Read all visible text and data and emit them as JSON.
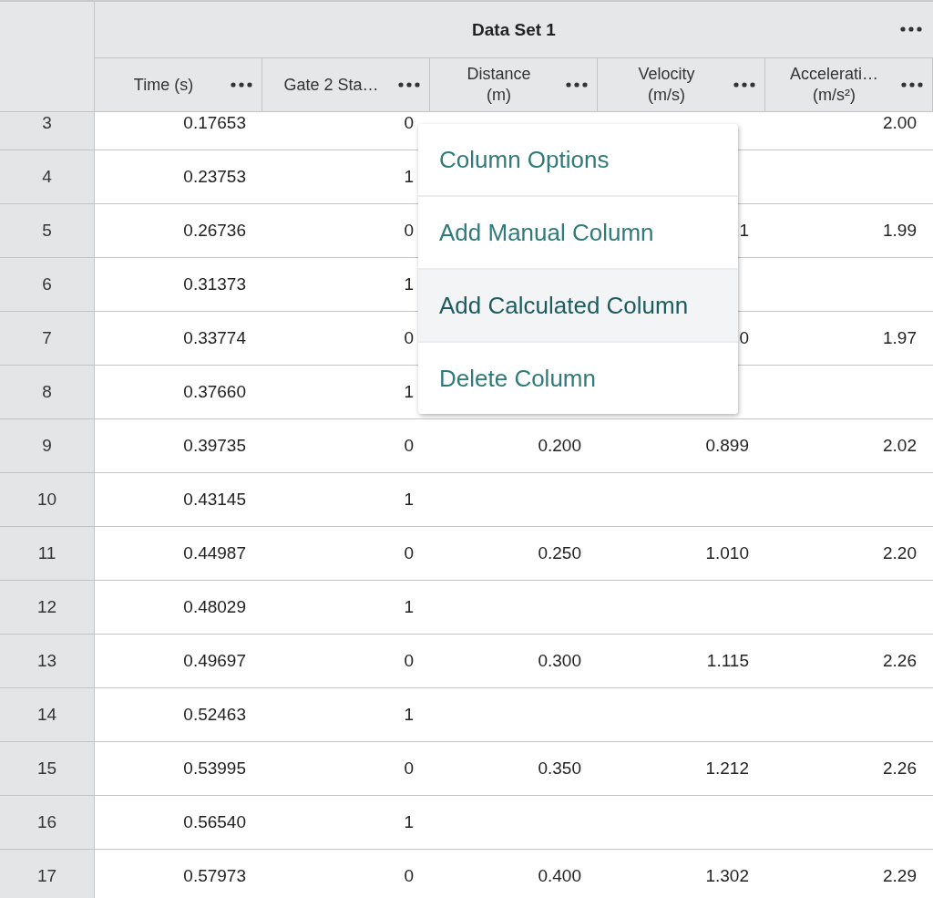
{
  "table": {
    "title": "Data Set 1",
    "columns": [
      {
        "lines": [
          "Time (s)"
        ]
      },
      {
        "lines": [
          "Gate 2 Sta…"
        ]
      },
      {
        "lines": [
          "Distance",
          "(m)"
        ]
      },
      {
        "lines": [
          "Velocity",
          "(m/s)"
        ]
      },
      {
        "lines": [
          "Accelerati…",
          "(m/s²)"
        ]
      }
    ],
    "rows": [
      {
        "index": "3",
        "cells": [
          "0.17653",
          "0",
          null,
          null,
          "2.00"
        ]
      },
      {
        "index": "4",
        "cells": [
          "0.23753",
          "1",
          null,
          null,
          null
        ]
      },
      {
        "index": "5",
        "cells": [
          "0.26736",
          "0",
          null,
          "1",
          "1.99"
        ]
      },
      {
        "index": "6",
        "cells": [
          "0.31373",
          "1",
          null,
          null,
          null
        ]
      },
      {
        "index": "7",
        "cells": [
          "0.33774",
          "0",
          null,
          "0",
          "1.97"
        ]
      },
      {
        "index": "8",
        "cells": [
          "0.37660",
          "1",
          null,
          null,
          null
        ]
      },
      {
        "index": "9",
        "cells": [
          "0.39735",
          "0",
          "0.200",
          "0.899",
          "2.02"
        ]
      },
      {
        "index": "10",
        "cells": [
          "0.43145",
          "1",
          null,
          null,
          null
        ]
      },
      {
        "index": "11",
        "cells": [
          "0.44987",
          "0",
          "0.250",
          "1.010",
          "2.20"
        ]
      },
      {
        "index": "12",
        "cells": [
          "0.48029",
          "1",
          null,
          null,
          null
        ]
      },
      {
        "index": "13",
        "cells": [
          "0.49697",
          "0",
          "0.300",
          "1.115",
          "2.26"
        ]
      },
      {
        "index": "14",
        "cells": [
          "0.52463",
          "1",
          null,
          null,
          null
        ]
      },
      {
        "index": "15",
        "cells": [
          "0.53995",
          "0",
          "0.350",
          "1.212",
          "2.26"
        ]
      },
      {
        "index": "16",
        "cells": [
          "0.56540",
          "1",
          null,
          null,
          null
        ]
      },
      {
        "index": "17",
        "cells": [
          "0.57973",
          "0",
          "0.400",
          "1.302",
          "2.29"
        ]
      }
    ]
  },
  "context_menu": {
    "items": [
      {
        "label": "Column Options",
        "highlighted": false
      },
      {
        "label": "Add Manual Column",
        "highlighted": false
      },
      {
        "label": "Add Calculated Column",
        "highlighted": true
      },
      {
        "label": "Delete Column",
        "highlighted": false
      }
    ]
  }
}
